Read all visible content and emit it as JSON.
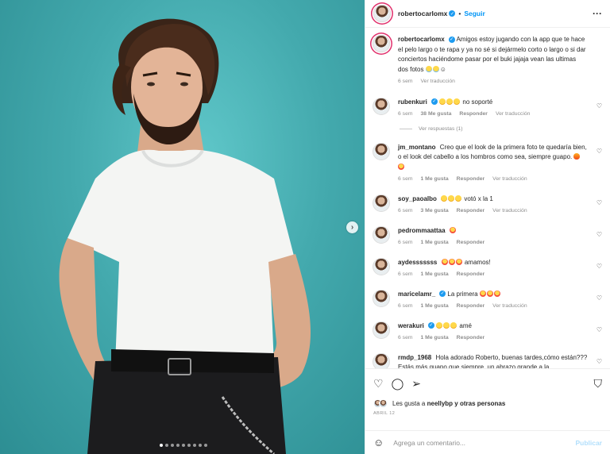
{
  "header": {
    "username": "robertocarlomx",
    "follow_label": "Seguir",
    "more_icon": "more-horizontal-icon"
  },
  "caption": {
    "username": "robertocarlomx",
    "text": "Amigos estoy jugando con la app que te hace el pelo largo o te rapa y ya no sé si dejármelo corto o largo o si dar conciertos haciéndome pasar por el buki jajaja vean las ultimas dos fotos",
    "time": "6 sem",
    "translate_label": "Ver traducción"
  },
  "comments": [
    {
      "username": "rubenkuri",
      "verified": true,
      "text": "no soporté",
      "time": "6 sem",
      "likes": "38 Me gusta",
      "reply_label": "Responder",
      "translate_label": "Ver traducción",
      "view_replies": "Ver respuestas (1)"
    },
    {
      "username": "jm_montano",
      "verified": false,
      "text": "Creo que el look de la primera foto te quedaría bien, o el look del cabello a los hombros como sea, siempre guapo.",
      "time": "6 sem",
      "likes": "1 Me gusta",
      "reply_label": "Responder",
      "translate_label": "Ver traducción"
    },
    {
      "username": "soy_paoalbo",
      "verified": false,
      "text": "votó x la 1",
      "time": "6 sem",
      "likes": "3 Me gusta",
      "reply_label": "Responder",
      "translate_label": "Ver traducción"
    },
    {
      "username": "pedrommaattaa",
      "verified": false,
      "text": "",
      "time": "6 sem",
      "likes": "1 Me gusta",
      "reply_label": "Responder"
    },
    {
      "username": "aydesssssss",
      "verified": false,
      "text": "amamos!",
      "time": "6 sem",
      "likes": "1 Me gusta",
      "reply_label": "Responder"
    },
    {
      "username": "maricelamr_",
      "verified": true,
      "text": "La primera",
      "time": "6 sem",
      "likes": "1 Me gusta",
      "reply_label": "Responder",
      "translate_label": "Ver traducción"
    },
    {
      "username": "werakuri",
      "verified": true,
      "text": "amé",
      "time": "6 sem",
      "likes": "1 Me gusta",
      "reply_label": "Responder"
    },
    {
      "username": "rmdp_1968",
      "verified": false,
      "text": "Hola adorado Roberto, buenas tardes,cómo están??? Estás más guapo que siempre, un abrazo grande a la"
    }
  ],
  "actions": {
    "likes_text": "Les gusta a",
    "liked_by": "neellybp",
    "others_text": "y otras personas",
    "date": "ABRIL 12"
  },
  "add_comment": {
    "placeholder": "Agrega un comentario...",
    "publish_label": "Publicar"
  },
  "carousel": {
    "total": 9,
    "active": 1
  },
  "colors": {
    "accent": "#0095f6",
    "background_teal": "#43a9ad"
  }
}
